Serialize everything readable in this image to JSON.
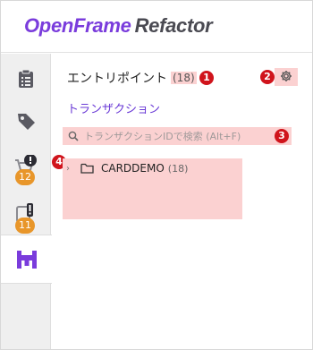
{
  "header": {
    "logo_part1": "OpenFrame",
    "logo_part2": "Refactor"
  },
  "rail": {
    "items": [
      {
        "icon": "clipboard-icon"
      },
      {
        "icon": "tag-icon"
      },
      {
        "icon": "cart-alert-icon",
        "badge": "12"
      },
      {
        "icon": "clipboard-alert-icon",
        "badge": "11"
      },
      {
        "icon": "entry-point-icon",
        "active": true
      }
    ]
  },
  "panel": {
    "title": "エントリポイント",
    "count": "(18)",
    "tab_label": "トランザクション",
    "search": {
      "placeholder": "トランザクションIDで検索 (Alt+F)",
      "value": ""
    },
    "tree": [
      {
        "label": "CARDDEMO",
        "count": "(18)"
      }
    ]
  },
  "markers": [
    "1",
    "2",
    "3",
    "4"
  ],
  "colors": {
    "brand": "#7a3cdc",
    "highlight": "#fbd1d1",
    "marker": "#d0141c",
    "badge": "#e8962a",
    "link": "#6a3ad6"
  }
}
